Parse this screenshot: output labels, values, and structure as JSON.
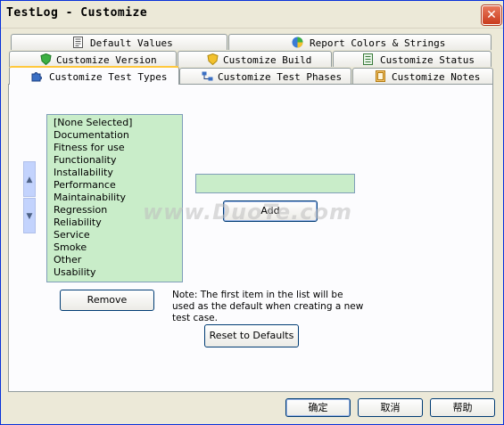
{
  "window": {
    "title": "TestLog - Customize",
    "close_glyph": "✕"
  },
  "tabs": {
    "row1": [
      {
        "label": "Default Values",
        "icon": "document-icon"
      },
      {
        "label": "Report Colors & Strings",
        "icon": "pie-chart-icon"
      }
    ],
    "row2": [
      {
        "label": "Customize Version",
        "icon": "shield-icon"
      },
      {
        "label": "Customize Build",
        "icon": "shield-icon"
      },
      {
        "label": "Customize Status",
        "icon": "checklist-icon"
      }
    ],
    "row3": [
      {
        "label": "Customize Test Types",
        "icon": "puzzle-icon",
        "active": true
      },
      {
        "label": "Customize Test Phases",
        "icon": "flow-icon"
      },
      {
        "label": "Customize Notes",
        "icon": "notebook-icon"
      }
    ]
  },
  "types_list": {
    "items": [
      "[None Selected]",
      "Documentation",
      "Fitness for use",
      "Functionality",
      "Installability",
      "Performance",
      "Maintainability",
      "Regression",
      "Reliability",
      "Service",
      "Smoke",
      "Other",
      "Usability"
    ]
  },
  "scroll": {
    "up_glyph": "▲",
    "down_glyph": "▼"
  },
  "new_type_input": {
    "value": ""
  },
  "buttons": {
    "add": "Add",
    "remove": "Remove",
    "reset": "Reset to Defaults",
    "ok": "确定",
    "cancel": "取消",
    "help": "帮助"
  },
  "note": "Note: The first item in the list will be used as the default when creating a new test case.",
  "watermark": "www.DuoTe.com",
  "colors": {
    "list_bg": "#c9edc9",
    "active_tab_accent": "#ffc83c",
    "dialog_bg": "#ece9d8"
  }
}
